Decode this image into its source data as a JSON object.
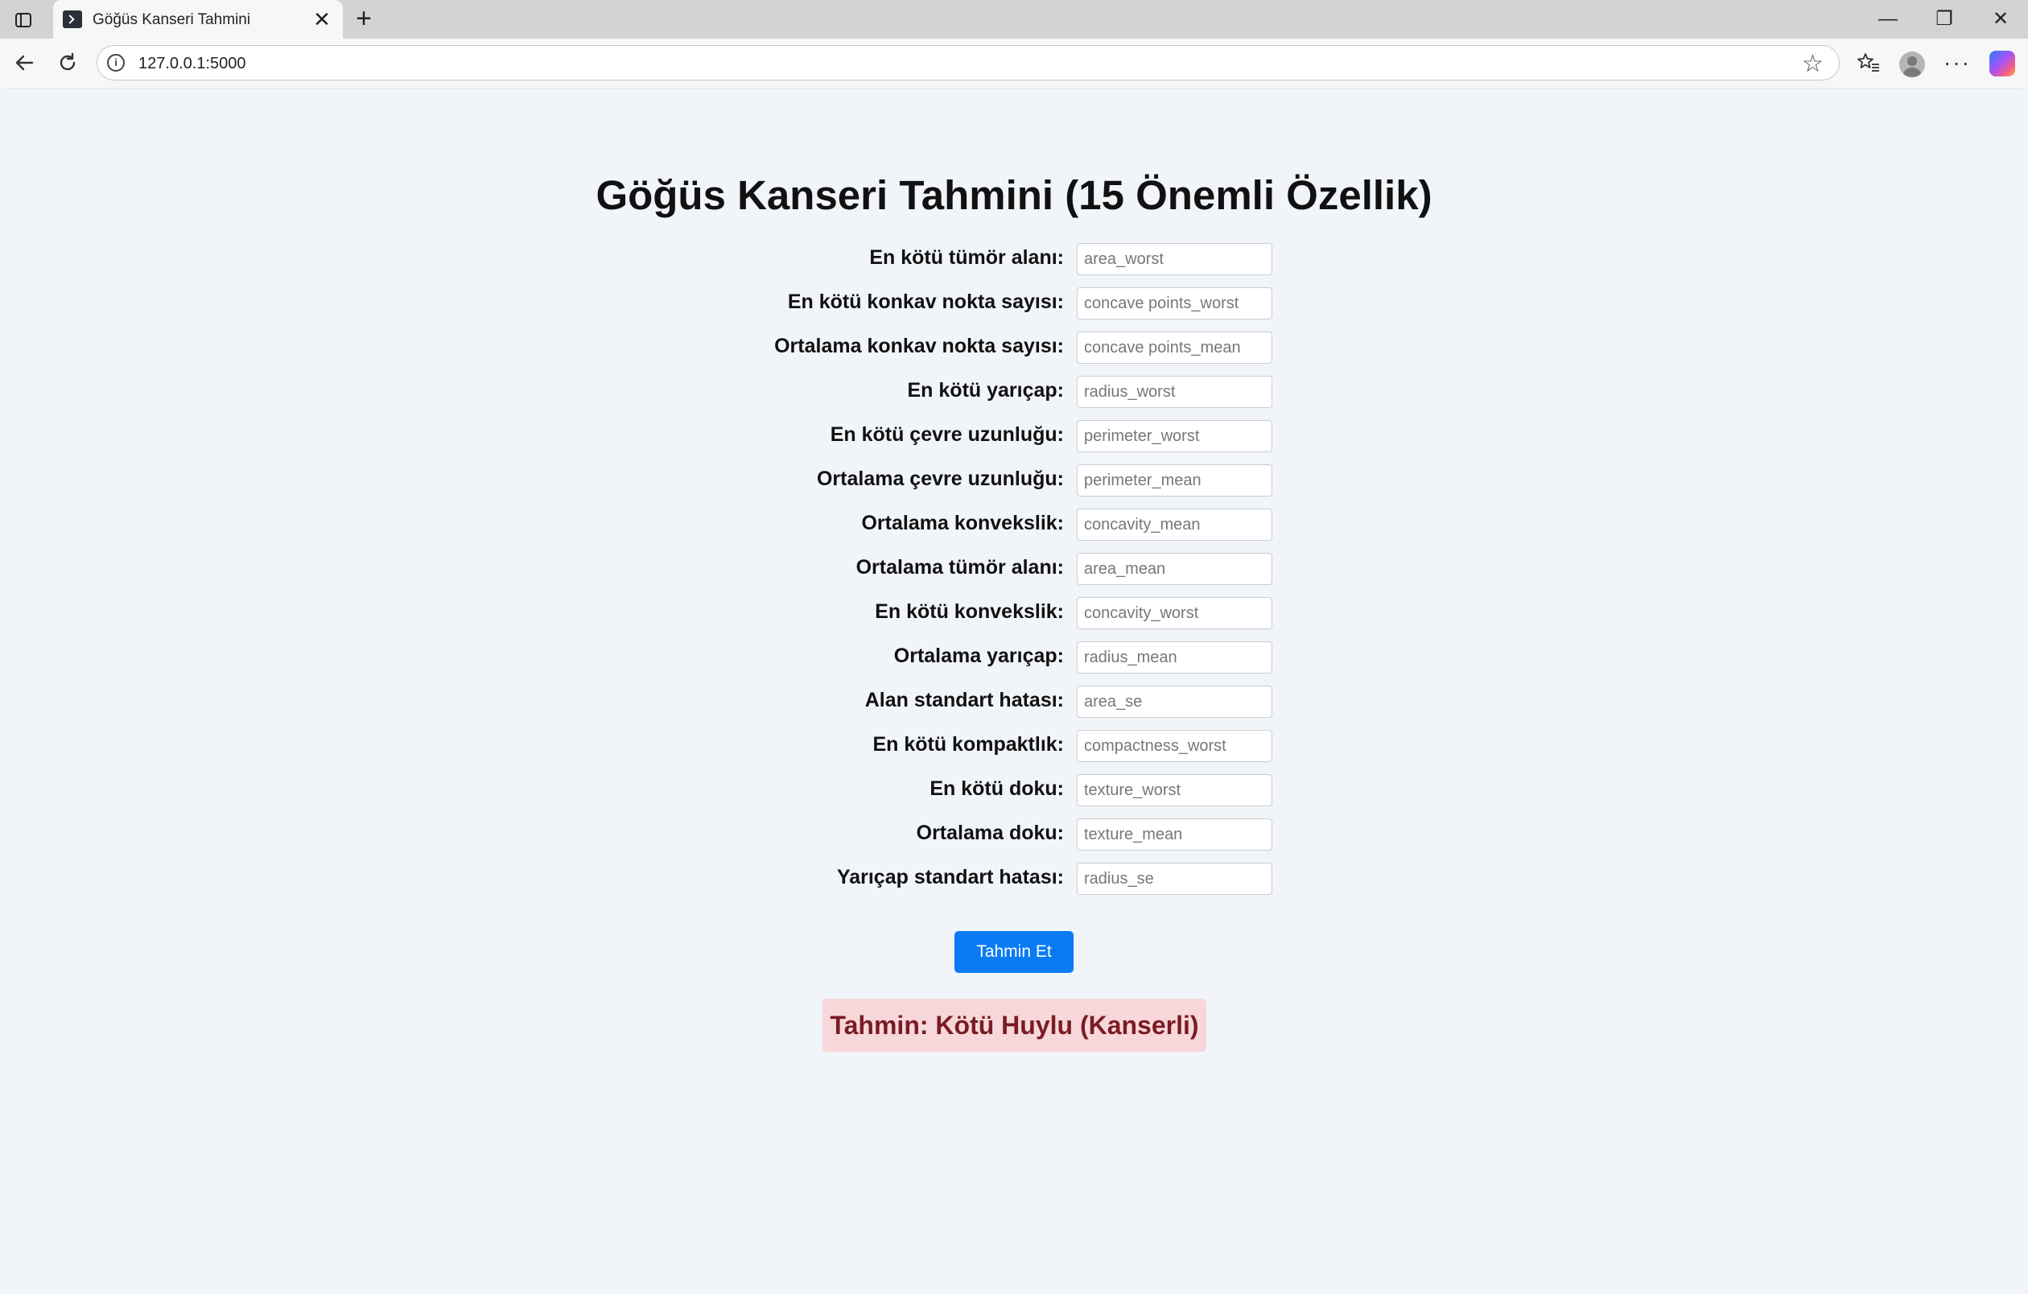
{
  "browser": {
    "tab_title": "Göğüs Kanseri Tahmini",
    "url": "127.0.0.1:5000",
    "close_glyph": "✕",
    "new_tab_glyph": "+",
    "minimize_glyph": "—",
    "restore_glyph": "❐",
    "window_close_glyph": "✕"
  },
  "page": {
    "title": "Göğüs Kanseri Tahmini (15 Önemli Özellik)",
    "fields": [
      {
        "label": "En kötü tümör alanı:",
        "placeholder": "area_worst"
      },
      {
        "label": "En kötü konkav nokta sayısı:",
        "placeholder": "concave points_worst"
      },
      {
        "label": "Ortalama konkav nokta sayısı:",
        "placeholder": "concave points_mean"
      },
      {
        "label": "En kötü yarıçap:",
        "placeholder": "radius_worst"
      },
      {
        "label": "En kötü çevre uzunluğu:",
        "placeholder": "perimeter_worst"
      },
      {
        "label": "Ortalama çevre uzunluğu:",
        "placeholder": "perimeter_mean"
      },
      {
        "label": "Ortalama konvekslik:",
        "placeholder": "concavity_mean"
      },
      {
        "label": "Ortalama tümör alanı:",
        "placeholder": "area_mean"
      },
      {
        "label": "En kötü konvekslik:",
        "placeholder": "concavity_worst"
      },
      {
        "label": "Ortalama yarıçap:",
        "placeholder": "radius_mean"
      },
      {
        "label": "Alan standart hatası:",
        "placeholder": "area_se"
      },
      {
        "label": "En kötü kompaktlık:",
        "placeholder": "compactness_worst"
      },
      {
        "label": "En kötü doku:",
        "placeholder": "texture_worst"
      },
      {
        "label": "Ortalama doku:",
        "placeholder": "texture_mean"
      },
      {
        "label": "Yarıçap standart hatası:",
        "placeholder": "radius_se"
      }
    ],
    "submit_label": "Tahmin Et",
    "result_text": "Tahmin: Kötü Huylu (Kanserli)"
  },
  "colors": {
    "page_background": "#f1f4f9",
    "button": "#0a7bf5",
    "result_background": "#f8d7da",
    "result_text": "#7a1c24"
  }
}
